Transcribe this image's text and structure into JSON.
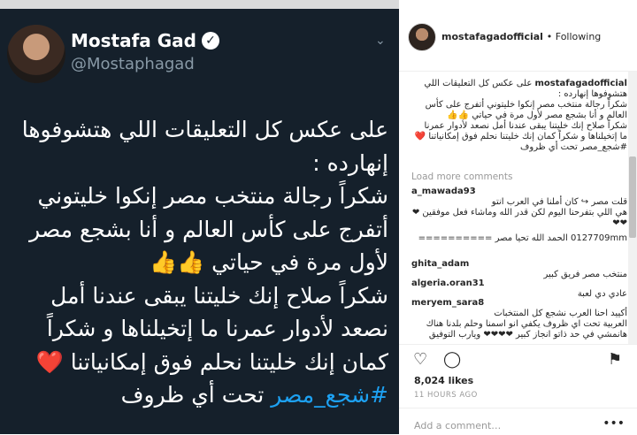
{
  "tweet": {
    "name": "Mostafa Gad",
    "handle": "@Mostaphagad",
    "body": "على عكس كل التعليقات اللي هتشوفوها\nإنهارده :\nشكراً رجالة منتخب مصر إنكوا خليتوني\nأتفرج على كأس العالم و أنا بشجع مصر\nلأول مرة في حياتي 👍👍\nشكراً صلاح إنك خليتنا يبقى عندنا أمل\nنصعد لأدوار عمرنا ما إتخيلناها و شكراً\nكمان إنك خليتنا نحلم فوق إمكانياتنا ❤️",
    "hashtag": "#شجع_مصر",
    "last_line_tail": " تحت أي ظروف"
  },
  "post": {
    "username": "mostafagadofficial",
    "follow_status": "• Following",
    "caption_user": "mostafagadofficial",
    "caption": "على عكس كل التعليقات اللي\nهتشوفوها إنهارده :\nشكراً رجالة منتخب مصر إنكوا خليتوني أتفرج على كأس\nالعالم و أنا بشجع مصر لأول مرة في حياتي 👍👍\nشكراً صلاح إنك خليتنا يبقى عندنا أمل نصعد لأدوار عمرنا\nما إتخيلناها و شكراً كمان إنك خليتنا نحلم فوق إمكانياتنا ❤️\n#شجع_مصر تحت أي ظروف",
    "load_more": "Load more comments",
    "comments": [
      {
        "user": "a_mawada93",
        "text": "قلت مصر ↪ كان أملنا في العرب انتو\nهي اللي بتفرحنا اليوم لكن قدر الله وماشاء فعل موفقين ❤\n❤❤"
      },
      {
        "user": "",
        "text": "0127709mm الحمد الله تحيا مصر =========="
      },
      {
        "user": "ghita_adam",
        "text": "منتخب مصر فريق كبير"
      },
      {
        "user": "algeria.oran31",
        "text": "عادي دي لعبة"
      },
      {
        "user": "meryem_sara8",
        "text": "أكييد احنا العرب نشجع كل المنتخبات\nالعربية تحت اي ظروف يكفي انو اسمنا وحلم بلدنا هناك\nهانمشي في حد ذاتو انجاز كبير ❤❤❤❤ ويارب التوفيق"
      }
    ],
    "likes": "8,024 likes",
    "time": "11 HOURS AGO",
    "add_comment": "Add a comment…",
    "more": "•••"
  }
}
